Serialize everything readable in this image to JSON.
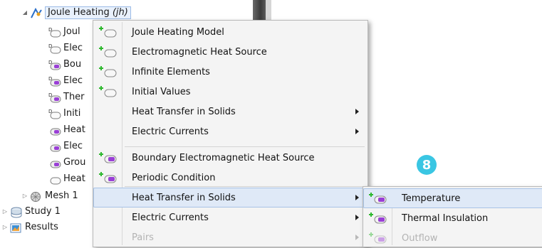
{
  "tree": {
    "root": {
      "label": "Joule Heating ",
      "tag": "(jh)"
    },
    "children": [
      {
        "label": "Joul",
        "icon": "d-node-icon"
      },
      {
        "label": "Elec",
        "icon": "d-node-icon"
      },
      {
        "label": "Bou",
        "icon": "d-boundary-icon"
      },
      {
        "label": "Elec",
        "icon": "d-boundary-icon"
      },
      {
        "label": "Ther",
        "icon": "d-boundary-icon"
      },
      {
        "label": "Initi",
        "icon": "d-node-icon"
      },
      {
        "label": "Heat",
        "icon": "boundary-icon"
      },
      {
        "label": "Elec",
        "icon": "boundary-icon"
      },
      {
        "label": "Grou",
        "icon": "boundary-icon"
      },
      {
        "label": "Heat",
        "icon": "domain-icon"
      }
    ],
    "mesh": "Mesh 1",
    "study": "Study 1",
    "results": "Results"
  },
  "menu": {
    "items": [
      {
        "label": "Joule Heating Model",
        "icon": "add-domain-icon"
      },
      {
        "label": "Electromagnetic Heat Source",
        "icon": "add-domain-icon"
      },
      {
        "label": "Infinite Elements",
        "icon": "add-domain-icon"
      },
      {
        "label": "Initial Values",
        "icon": "add-domain-icon"
      },
      {
        "label": "Heat Transfer in Solids",
        "submenu": true
      },
      {
        "label": "Electric Currents",
        "submenu": true
      },
      {
        "label": "Boundary Electromagnetic Heat Source",
        "icon": "add-boundary-icon"
      },
      {
        "label": "Periodic Condition",
        "icon": "add-boundary-icon"
      },
      {
        "label": "Heat Transfer in Solids",
        "submenu": true,
        "highlighted": true
      },
      {
        "label": "Electric Currents",
        "submenu": true
      },
      {
        "label": "Pairs",
        "submenu": true,
        "disabled": true
      }
    ]
  },
  "submenu": {
    "items": [
      {
        "label": "Temperature",
        "icon": "add-boundary-icon",
        "highlighted": true
      },
      {
        "label": "Thermal Insulation",
        "icon": "add-boundary-icon"
      },
      {
        "label": "Outflow",
        "icon": "add-boundary-icon",
        "disabled": true
      }
    ]
  },
  "callout": {
    "number": "8",
    "color": "#3ac6e3"
  },
  "colors": {
    "highlight": "#dfe9f7",
    "menu_bg": "#f4f4f4",
    "plus": "#2eb82e",
    "boundary": "#9a3fd6"
  }
}
